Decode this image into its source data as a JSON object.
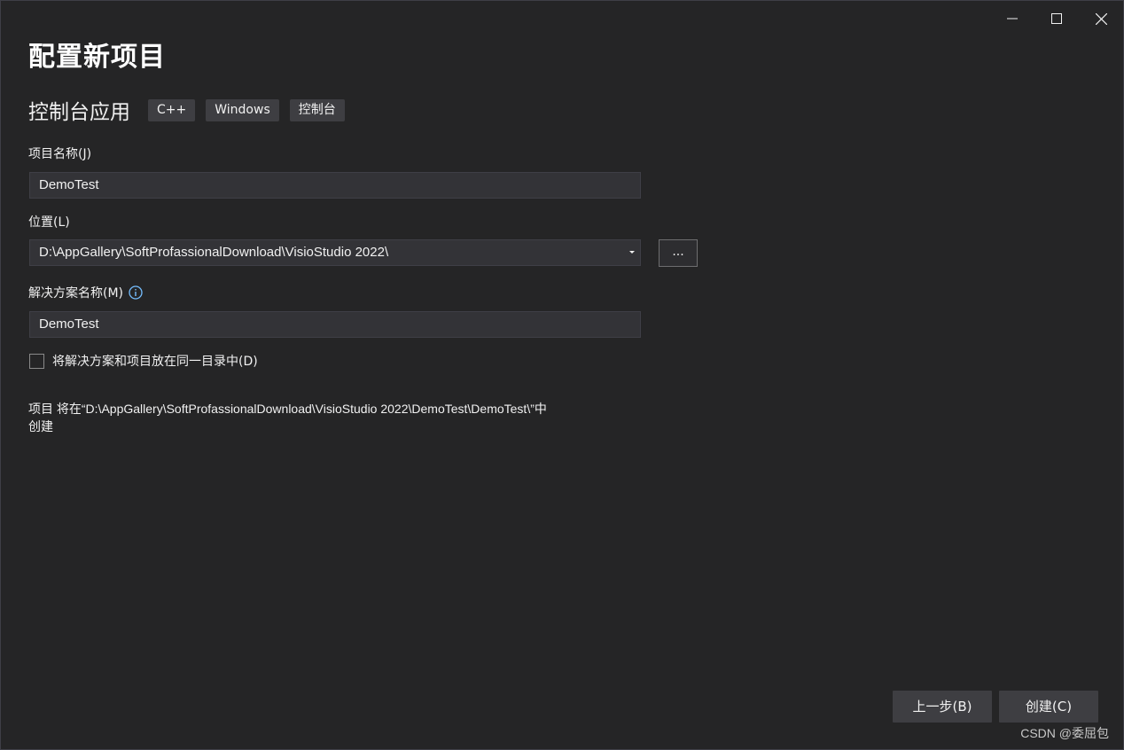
{
  "window": {
    "controls": {
      "minimize_icon": "minimize-icon",
      "maximize_icon": "maximize-icon",
      "close_icon": "close-icon"
    }
  },
  "page": {
    "title": "配置新项目"
  },
  "template": {
    "name": "控制台应用",
    "tags": [
      "C++",
      "Windows",
      "控制台"
    ]
  },
  "form": {
    "project_name": {
      "label": "项目名称(J)",
      "value": "DemoTest"
    },
    "location": {
      "label": "位置(L)",
      "value": "D:\\AppGallery\\SoftProfassionalDownload\\VisioStudio 2022\\",
      "browse_label": "..."
    },
    "solution_name": {
      "label": "解决方案名称(M)",
      "value": "DemoTest",
      "info_icon": "info-icon"
    },
    "same_directory": {
      "label": "将解决方案和项目放在同一目录中(D)",
      "checked": false
    }
  },
  "summary": {
    "line1": "项目 将在“D:\\AppGallery\\SoftProfassionalDownload\\VisioStudio 2022\\DemoTest\\DemoTest\\”中",
    "line2": "创建"
  },
  "footer": {
    "back_label": "上一步(B)",
    "create_label": "创建(C)"
  },
  "watermark": "CSDN @委屈包",
  "colors": {
    "background": "#252526",
    "field": "#333337",
    "button": "#3e3e42",
    "info": "#75beff"
  }
}
